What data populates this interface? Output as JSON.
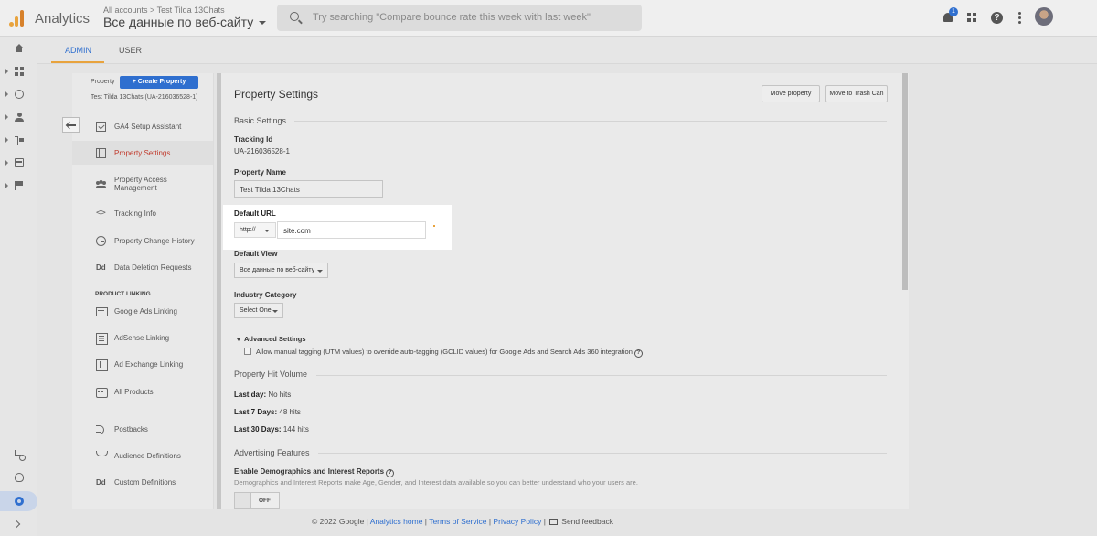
{
  "header": {
    "app_name": "Analytics",
    "breadcrumb": "All accounts > Test Tilda 13Chats",
    "account_view": "Все данные по веб-сайту",
    "search_placeholder": "Try searching \"Compare bounce rate this week with last week\"",
    "notification_count": "1"
  },
  "tabs": {
    "admin": "ADMIN",
    "user": "USER"
  },
  "nav": {
    "property_label": "Property",
    "create_property": "+ Create Property",
    "property_name": "Test Tilda 13Chats (UA-216036528-1)",
    "items": [
      {
        "label": "GA4 Setup Assistant",
        "icon": "checkbox-icon"
      },
      {
        "label": "Property Settings",
        "icon": "panel-icon"
      },
      {
        "label": "Property Access Management",
        "icon": "people-icon"
      },
      {
        "label": "Tracking Info",
        "icon": "code-icon"
      },
      {
        "label": "Property Change History",
        "icon": "history-icon"
      },
      {
        "label": "Data Deletion Requests",
        "icon": "dd-icon"
      }
    ],
    "section_product_linking": "PRODUCT LINKING",
    "linking_items": [
      {
        "label": "Google Ads Linking",
        "icon": "google-ads-icon"
      },
      {
        "label": "AdSense Linking",
        "icon": "adsense-icon"
      },
      {
        "label": "Ad Exchange Linking",
        "icon": "ad-exchange-icon"
      },
      {
        "label": "All Products",
        "icon": "all-products-icon"
      }
    ],
    "other_items": [
      {
        "label": "Postbacks",
        "icon": "postbacks-icon"
      },
      {
        "label": "Audience Definitions",
        "icon": "audience-icon"
      },
      {
        "label": "Custom Definitions",
        "icon": "dd-icon"
      }
    ],
    "dd_glyph": "Dd",
    "code_glyph": "<>"
  },
  "main": {
    "title": "Property Settings",
    "move_property": "Move property",
    "move_to_trash": "Move to Trash Can",
    "basic_settings": "Basic Settings",
    "tracking_id_label": "Tracking Id",
    "tracking_id_value": "UA-216036528-1",
    "property_name_label": "Property Name",
    "property_name_value": "Test Tilda 13Chats",
    "default_url_label": "Default URL",
    "url_protocol": "http://",
    "url_value": "site.com",
    "default_view_label": "Default View",
    "default_view_value": "Все данные по веб-сайту",
    "industry_label": "Industry Category",
    "industry_value": "Select One",
    "advanced_settings": "Advanced Settings",
    "manual_tagging": "Allow manual tagging (UTM values) to override auto-tagging (GCLID values) for Google Ads and Search Ads 360 integration",
    "hit_volume": "Property Hit Volume",
    "last_day_label": "Last day:",
    "last_day_value": " No hits",
    "last_7_label": "Last 7 Days:",
    "last_7_value": " 48 hits",
    "last_30_label": "Last 30 Days:",
    "last_30_value": " 144 hits",
    "advertising_features": "Advertising Features",
    "demographics_label": "Enable Demographics and Interest Reports",
    "demographics_desc": "Demographics and Interest Reports make Age, Gender, and Interest data available so you can better understand who your users are.",
    "toggle_state": "OFF",
    "help_glyph": "?"
  },
  "footer": {
    "copyright": "© 2022 Google | ",
    "analytics_home": "Analytics home",
    "sep": " | ",
    "terms": "Terms of Service",
    "privacy": "Privacy Policy",
    "send_feedback": "Send feedback"
  },
  "colors": {
    "accent_blue": "#2f6fcf",
    "brand_orange": "#e8a33d",
    "active_red": "#c0392b"
  }
}
